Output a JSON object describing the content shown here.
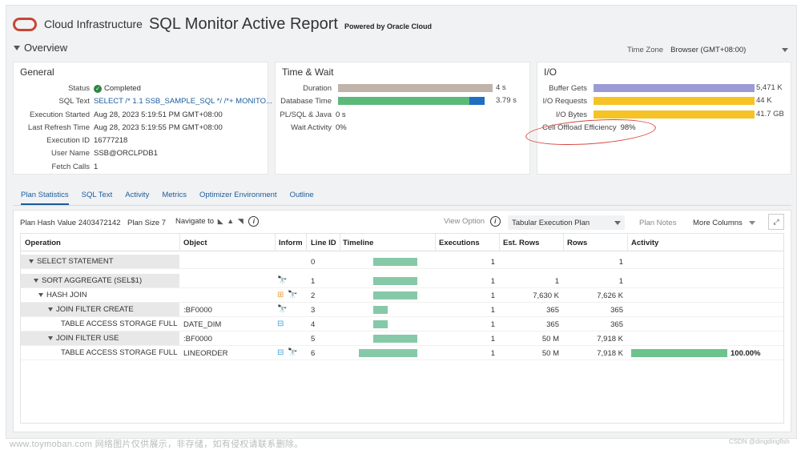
{
  "header": {
    "brand": "Cloud Infrastructure",
    "title": "SQL Monitor Active Report",
    "powered_by": "Powered by Oracle Cloud"
  },
  "overview": {
    "label": "Overview",
    "time_zone_label": "Time Zone",
    "time_zone_value": "Browser (GMT+08:00)"
  },
  "general": {
    "title": "General",
    "rows": [
      {
        "label": "Status",
        "value": "Completed"
      },
      {
        "label": "SQL Text",
        "value": "SELECT /* 1.1 SSB_SAMPLE_SQL */ /*+ MONITO..."
      },
      {
        "label": "Execution Started",
        "value": "Aug 28, 2023 5:19:51 PM GMT+08:00"
      },
      {
        "label": "Last Refresh Time",
        "value": "Aug 28, 2023 5:19:55 PM GMT+08:00"
      },
      {
        "label": "Execution ID",
        "value": "16777218"
      },
      {
        "label": "User Name",
        "value": "SSB@ORCLPDB1"
      },
      {
        "label": "Fetch Calls",
        "value": "1"
      }
    ]
  },
  "time_wait": {
    "title": "Time & Wait",
    "rows": [
      {
        "label": "Duration",
        "value": "4 s"
      },
      {
        "label": "Database Time",
        "value": "3.79 s"
      },
      {
        "label": "PL/SQL & Java",
        "value": "0 s"
      },
      {
        "label": "Wait Activity",
        "value": "0%"
      }
    ]
  },
  "io": {
    "title": "I/O",
    "rows": [
      {
        "label": "Buffer Gets",
        "value": "5,471 K"
      },
      {
        "label": "I/O Requests",
        "value": "44 K"
      },
      {
        "label": "I/O Bytes",
        "value": "41.7 GB"
      },
      {
        "label": "Cell Offload Efficiency",
        "value": "98%"
      }
    ]
  },
  "tabs": [
    "Plan Statistics",
    "SQL Text",
    "Activity",
    "Metrics",
    "Optimizer Environment",
    "Outline"
  ],
  "toolbar": {
    "plan_hash": "Plan Hash Value 2403472142",
    "plan_size": "Plan Size 7",
    "navigate_to": "Navigate to",
    "view_option": "View Option",
    "view_select": "Tabular Execution Plan",
    "plan_notes": "Plan Notes",
    "more_columns": "More Columns"
  },
  "columns": [
    "Operation",
    "Object",
    "Inform",
    "Line ID",
    "Timeline",
    "Executions",
    "Est. Rows",
    "Rows",
    "Activity"
  ],
  "rows": [
    {
      "op": "SELECT STATEMENT",
      "obj": "",
      "line": "0",
      "exec": "1",
      "est": "",
      "rows": "1",
      "activity": ""
    },
    {
      "op": "SORT AGGREGATE (SEL$1)",
      "obj": "",
      "line": "1",
      "exec": "1",
      "est": "1",
      "rows": "1",
      "activity": ""
    },
    {
      "op": "HASH JOIN",
      "obj": "",
      "line": "2",
      "exec": "1",
      "est": "7,630 K",
      "rows": "7,626 K",
      "activity": ""
    },
    {
      "op": "JOIN FILTER CREATE",
      "obj": ":BF0000",
      "line": "3",
      "exec": "1",
      "est": "365",
      "rows": "365",
      "activity": ""
    },
    {
      "op": "TABLE ACCESS STORAGE FULL (SEL$",
      "obj": "DATE_DIM",
      "line": "4",
      "exec": "1",
      "est": "365",
      "rows": "365",
      "activity": ""
    },
    {
      "op": "JOIN FILTER USE",
      "obj": ":BF0000",
      "line": "5",
      "exec": "1",
      "est": "50 M",
      "rows": "7,918 K",
      "activity": ""
    },
    {
      "op": "TABLE ACCESS STORAGE FULL (SEL$",
      "obj": "LINEORDER",
      "line": "6",
      "exec": "1",
      "est": "50 M",
      "rows": "7,918 K",
      "activity": "100.00%"
    }
  ],
  "watermark": "www.toymoban.com 网络图片仅供展示，非存储，如有侵权请联系删除。",
  "watermark2": "CSDN @dingdingfish"
}
